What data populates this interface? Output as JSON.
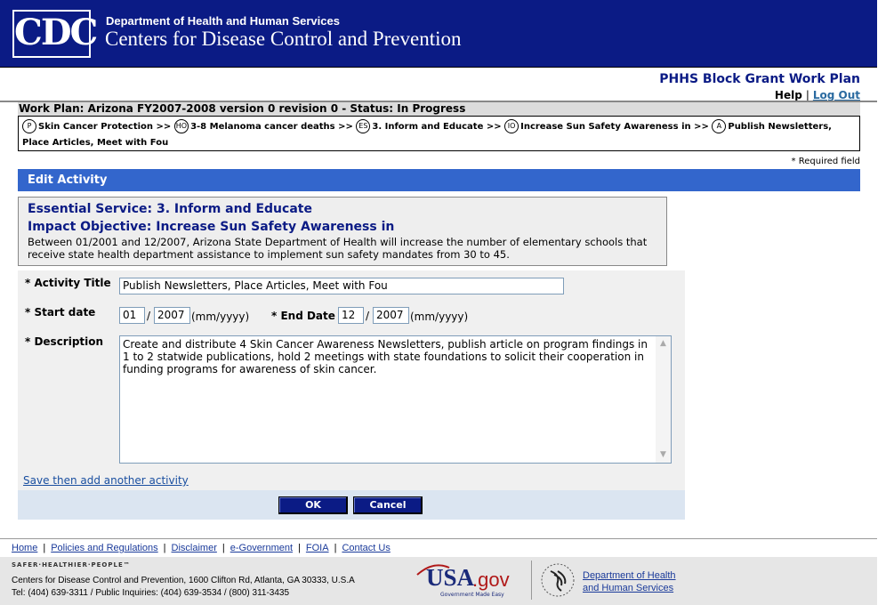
{
  "header": {
    "logo_text": "CDC",
    "department": "Department of Health and Human Services",
    "agency": "Centers for Disease Control and Prevention"
  },
  "app": {
    "title": "PHHS Block Grant Work Plan",
    "help": "Help",
    "separator": "|",
    "logout": "Log Out"
  },
  "workplan": {
    "status_line": "Work Plan: Arizona FY2007-2008 version 0 revision 0 - Status: In Progress"
  },
  "breadcrumb": [
    {
      "badge": "P",
      "label": "Skin Cancer Protection"
    },
    {
      "badge": "HO",
      "label": "3-8 Melanoma cancer deaths"
    },
    {
      "badge": "ES",
      "label": "3. Inform and Educate"
    },
    {
      "badge": "IO",
      "label": "Increase Sun Safety Awareness in"
    },
    {
      "badge": "A",
      "label": "Publish Newsletters, Place Articles, Meet with Fou"
    }
  ],
  "breadcrumb_sep": ">>",
  "required_note": "* Required field",
  "section_title": "Edit Activity",
  "context": {
    "essential_service": "Essential Service: 3. Inform and Educate",
    "impact_objective": "Impact Objective: Increase Sun Safety Awareness in",
    "description": "Between 01/2001 and 12/2007, Arizona State Department of Health will increase the number of elementary schools that receive state health department assistance to implement sun safety mandates from 30 to 45."
  },
  "form": {
    "activity_title_label": "* Activity Title",
    "activity_title_value": "Publish Newsletters, Place Articles, Meet with Fou",
    "start_date_label": "* Start date",
    "start_month": "01",
    "start_year": "2007",
    "end_date_label": "* End Date",
    "end_month": "12",
    "end_year": "2007",
    "date_sep": "/",
    "date_format": "(mm/yyyy)",
    "description_label": "* Description",
    "description_value": "Create and distribute 4 Skin Cancer Awareness Newsletters, publish article on program findings in 1 to 2 statwide publications, hold 2 meetings with state foundations to solicit their cooperation in funding programs for awareness of skin cancer.",
    "save_add_link": "Save then add another activity",
    "ok_button": "OK",
    "cancel_button": "Cancel"
  },
  "footer": {
    "links": [
      "Home",
      "Policies and Regulations",
      "Disclaimer",
      "e-Government",
      "FOIA",
      "Contact Us"
    ],
    "tagline": "SAFER·HEALTHIER·PEOPLE™",
    "address": "Centers for Disease Control and Prevention, 1600 Clifton Rd, Atlanta, GA 30333, U.S.A",
    "phone": "Tel: (404) 639-3311 / Public Inquiries: (404) 639-3534 / (800) 311-3435",
    "usagov_usa": "USA",
    "usagov_gov": ".gov",
    "usagov_tag": "Government Made Easy",
    "hhs_line1": "Department of Health",
    "hhs_line2": "and Human Services"
  },
  "colors": {
    "header_bg": "#0b1b85",
    "section_bar": "#3366cc",
    "button_bg": "#0b1b85",
    "link": "#1a4fa0"
  }
}
